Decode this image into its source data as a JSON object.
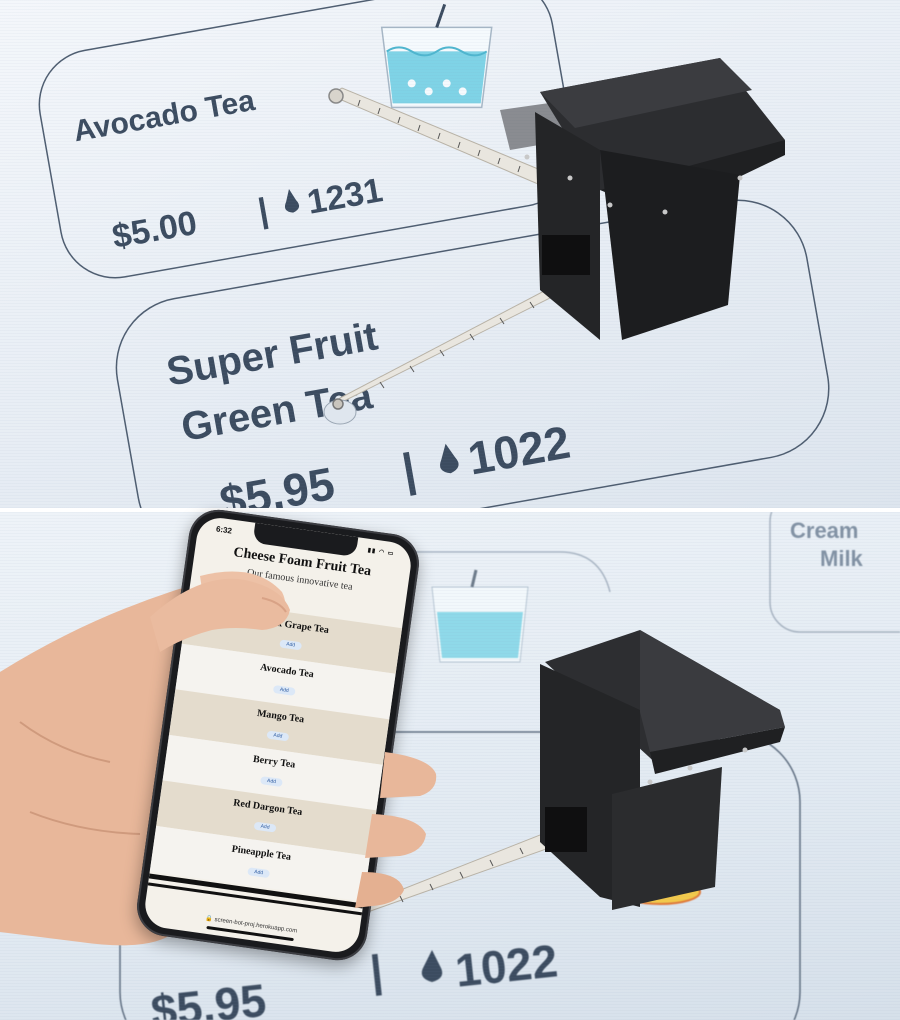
{
  "top_scene": {
    "card_top": {
      "name": "Avocado Tea",
      "price": "$5.00",
      "separator": "|",
      "count": "1231"
    },
    "card_main": {
      "name_line1": "Super Fruit",
      "name_line2": "Green Tea",
      "price": "$5.95",
      "separator": "|",
      "count": "1022"
    }
  },
  "bottom_scene": {
    "background_card": {
      "name_line1": "Cream",
      "name_line2": "Milk"
    },
    "card_main": {
      "price": "$5.95",
      "separator": "|",
      "count": "1022"
    },
    "phone": {
      "status": {
        "time": "6:32",
        "icons": "▮▮ ◠ ▭"
      },
      "header": {
        "title": "Cheese Foam Fruit Tea",
        "subtitle": "Our famous innovative tea"
      },
      "menu_items": [
        {
          "name": "Black Grape Tea",
          "button": "Add"
        },
        {
          "name": "Avocado Tea",
          "button": "Add"
        },
        {
          "name": "Mango Tea",
          "button": "Add"
        },
        {
          "name": "Berry Tea",
          "button": "Add"
        },
        {
          "name": "Red Dargon Tea",
          "button": "Add"
        },
        {
          "name": "Pineapple Tea",
          "button": "Add"
        }
      ],
      "url": "🔒 screen-bot-proj.herokuapp.com"
    }
  },
  "colors": {
    "screen_text": "#3c4c60",
    "device": "#2a2b2d",
    "tea_blue": "#7fd3e6",
    "tea_yellow": "#f2c94c"
  }
}
